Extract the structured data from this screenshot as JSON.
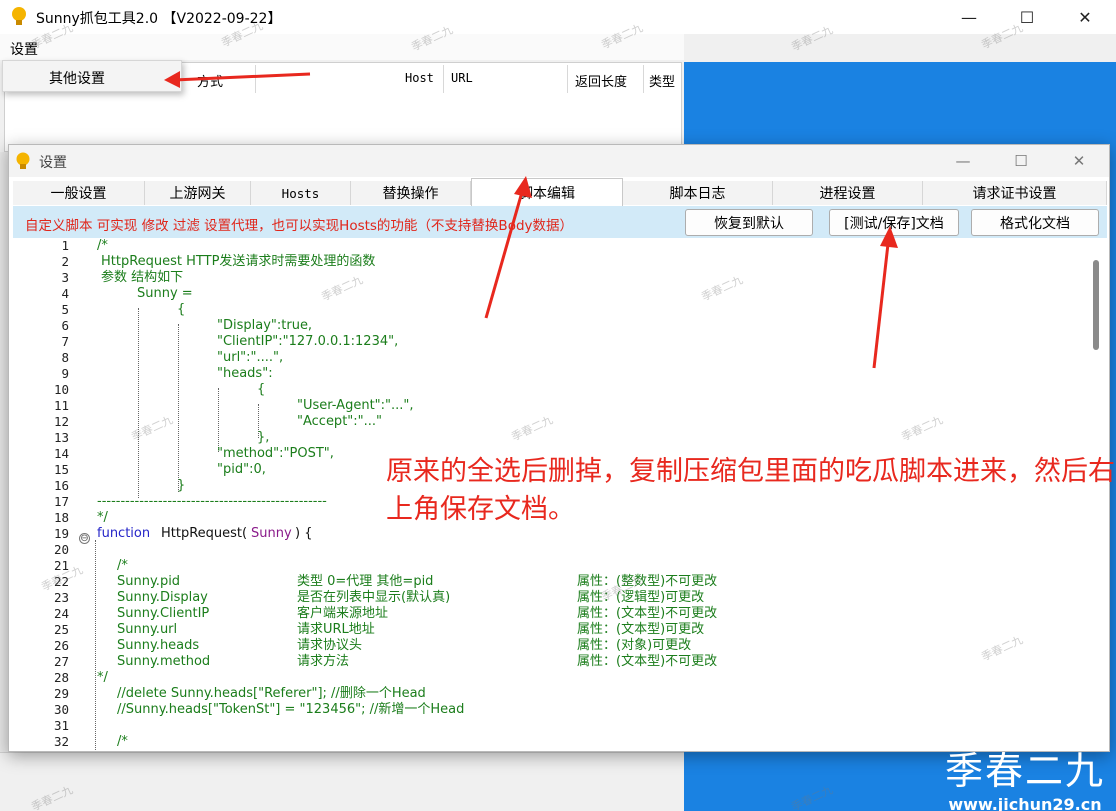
{
  "window": {
    "title": "Sunny抓包工具2.0 【V2022-09-22】",
    "minimize": "—",
    "maximize": "☐",
    "close": "✕"
  },
  "menubar": {
    "settings": "设置"
  },
  "dropdown": {
    "other_settings": "其他设置"
  },
  "list_columns": [
    "方式",
    "Host",
    "URL",
    "返回长度",
    "类型"
  ],
  "dialog": {
    "title": "设置",
    "tabs": [
      "一般设置",
      "上游网关",
      "Hosts",
      "替换操作",
      "脚本编辑",
      "脚本日志",
      "进程设置",
      "请求证书设置"
    ],
    "active_tab": "脚本编辑",
    "description": "自定义脚本 可实现 修改 过滤 设置代理，也可以实现Hosts的功能（不支持替换Body数据）",
    "buttons": {
      "restore": "恢复到默认",
      "test_save": "[测试/保存]文档",
      "format": "格式化文档"
    }
  },
  "editor": {
    "line_numbers": [
      "1",
      "2",
      "3",
      "4",
      "5",
      "6",
      "7",
      "8",
      "9",
      "10",
      "11",
      "12",
      "13",
      "14",
      "15",
      "16",
      "17",
      "18",
      "19",
      "20",
      "21",
      "22",
      "23",
      "24",
      "25",
      "26",
      "27",
      "28",
      "29",
      "30",
      "31",
      "32"
    ],
    "lines": {
      "l1": "/*",
      "l2": "HttpRequest HTTP发送请求时需要处理的函数",
      "l3": "参数 结构如下",
      "l4": "Sunny =",
      "l5": "{",
      "l6": "\"Display\":true,",
      "l7": "\"ClientIP\":\"127.0.0.1:1234\",",
      "l8": "\"url\":\"....\",",
      "l9": "\"heads\":",
      "l10": "{",
      "l11": "\"User-Agent\":\"...\",",
      "l12": "\"Accept\":\"...\"",
      "l13": "},",
      "l14": "\"method\":\"POST\",",
      "l15": "\"pid\":0,",
      "l16": "}",
      "l17": "-------------------------------------------------",
      "l18": "*/",
      "l19_kw": "function",
      "l19_name": "HttpRequest(",
      "l19_arg": "Sunny",
      "l19_end": ") {",
      "l21": "/*",
      "l22a": "Sunny.pid",
      "l22b": "类型 0=代理 其他=pid",
      "l22c": "属性：(整数型)不可更改",
      "l23a": "Sunny.Display",
      "l23b": "是否在列表中显示(默认真)",
      "l23c": "属性：(逻辑型)可更改",
      "l24a": "Sunny.ClientIP",
      "l24b": "客户端来源地址",
      "l24c": "属性：(文本型)不可更改",
      "l25a": "Sunny.url",
      "l25b": "请求URL地址",
      "l25c": "属性：(文本型)可更改",
      "l26a": "Sunny.heads",
      "l26b": "请求协议头",
      "l26c": "属性：(对象)可更改",
      "l27a": "Sunny.method",
      "l27b": "请求方法",
      "l27c": "属性：(文本型)不可更改",
      "l28": "*/",
      "l29": "//delete Sunny.heads[\"Referer\"]; //删除一个Head",
      "l30": "//Sunny.heads[\"TokenSt\"] = \"123456\"; //新增一个Head",
      "l32": "/*"
    },
    "fold_symbol": "⊖"
  },
  "annotation": "原来的全选后删掉，复制压缩包里面的吃瓜脚本进来，然后右上角保存文档。",
  "watermark": "季春二九",
  "logo": {
    "big": "季春二九",
    "url": "www.jichun29.cn"
  },
  "colors": {
    "accent_red": "#e8281e",
    "toolbar_bg": "#d2eaf8",
    "blue_panel": "#1a82e2",
    "code_green": "#1b7d1b",
    "code_blue": "#2525c8"
  }
}
